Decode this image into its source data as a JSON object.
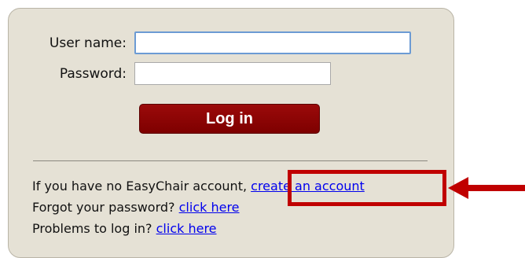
{
  "login": {
    "username_label": "User name:",
    "username_value": "",
    "password_label": "Password:",
    "password_value": "",
    "login_button_label": "Log in"
  },
  "links": {
    "no_account_text": "If you have no EasyChair account, ",
    "create_account_link": "create an account",
    "forgot_password_text": "Forgot your password? ",
    "forgot_password_link": "click here",
    "problems_text": "Problems to log in? ",
    "problems_link": "click here"
  },
  "colors": {
    "panel_background": "#e5e1d5",
    "button_background": "#8b0000",
    "annotation_red": "#c00000",
    "link_blue": "#0000ee"
  },
  "annotations": {
    "highlight_target": "create-account-link",
    "arrow_icon": "left-arrow-icon"
  }
}
